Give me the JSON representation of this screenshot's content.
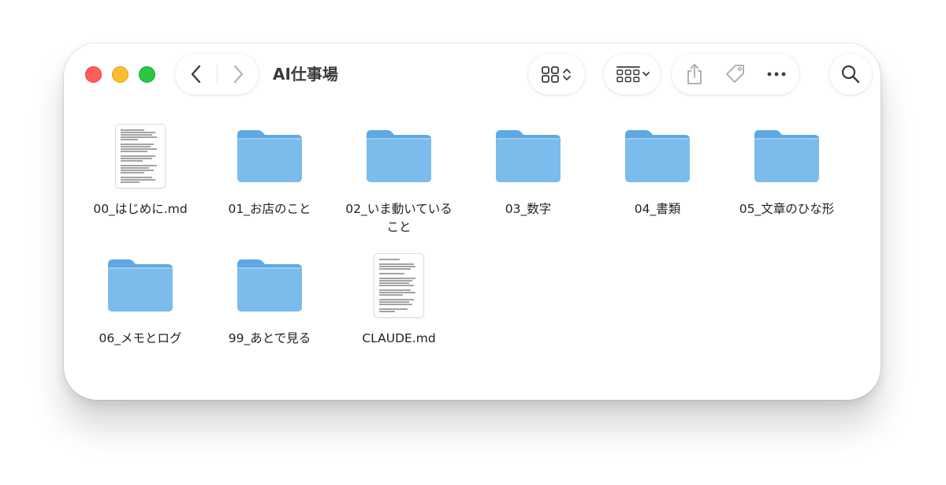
{
  "window": {
    "title": "AI仕事場"
  },
  "toolbar": {
    "back_icon": "chevron-left-icon",
    "forward_icon": "chevron-right-icon",
    "view_icon": "grid-view-icon",
    "group_icon": "group-by-icon",
    "share_icon": "share-icon",
    "tag_icon": "tag-icon",
    "more_icon": "ellipsis-icon",
    "search_icon": "search-icon"
  },
  "items": [
    {
      "name": "00_はじめに.md",
      "kind": "document"
    },
    {
      "name": "01_お店のこと",
      "kind": "folder"
    },
    {
      "name": "02_いま動いている\nこと",
      "kind": "folder"
    },
    {
      "name": "03_数字",
      "kind": "folder"
    },
    {
      "name": "04_書類",
      "kind": "folder"
    },
    {
      "name": "05_文章のひな形",
      "kind": "folder"
    },
    {
      "name": "06_メモとログ",
      "kind": "folder"
    },
    {
      "name": "99_あとで見る",
      "kind": "folder"
    },
    {
      "name": "CLAUDE.md",
      "kind": "document"
    }
  ],
  "colors": {
    "close": "#ff5f57",
    "minimize": "#febc2e",
    "zoom": "#28c840",
    "folder_front": "#7cbcec",
    "folder_back": "#5ea9e3"
  }
}
